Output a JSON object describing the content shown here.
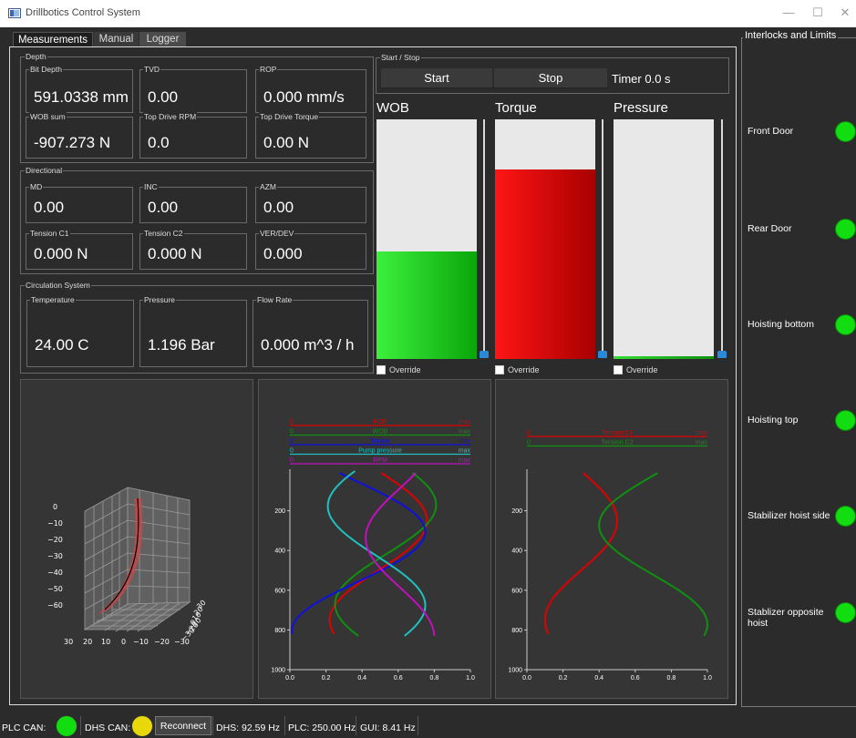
{
  "window": {
    "title": "Drillbotics Control System",
    "minimize": "—",
    "maximize": "☐",
    "close": "✕"
  },
  "tabs": [
    "Measurements",
    "Manual",
    "Logger"
  ],
  "depth": {
    "title": "Depth",
    "fields": [
      {
        "label": "Bit Depth",
        "value": "591.0338 mm"
      },
      {
        "label": "TVD",
        "value": "0.00"
      },
      {
        "label": "ROP",
        "value": "0.000 mm/s"
      },
      {
        "label": "WOB sum",
        "value": "-907.273 N"
      },
      {
        "label": "Top Drive RPM",
        "value": "0.0"
      },
      {
        "label": "Top Drive Torque",
        "value": "0.00 N"
      }
    ]
  },
  "directional": {
    "title": "Directional",
    "fields": [
      {
        "label": "MD",
        "value": "0.00"
      },
      {
        "label": "INC",
        "value": "0.00"
      },
      {
        "label": "AZM",
        "value": "0.00"
      },
      {
        "label": "Tension C1",
        "value": "0.000 N"
      },
      {
        "label": "Tension C2",
        "value": "0.000 N"
      },
      {
        "label": "VER/DEV",
        "value": "0.000"
      }
    ]
  },
  "circulation": {
    "title": "Circulation System",
    "fields": [
      {
        "label": "Temperature",
        "value": "24.00 C"
      },
      {
        "label": "Pressure",
        "value": "1.196 Bar"
      },
      {
        "label": "Flow Rate",
        "value": "0.000 m^3 / h"
      }
    ]
  },
  "start_stop": {
    "title": "Start / Stop",
    "start": "Start",
    "stop": "Stop",
    "timer": "Timer 0.0 s"
  },
  "gauges": [
    {
      "name": "WOB",
      "fill": 0.45,
      "color": "#1fd11f",
      "override": "Override"
    },
    {
      "name": "Torque",
      "fill": 0.79,
      "color": "#e00000",
      "override": "Override"
    },
    {
      "name": "Pressure",
      "fill": 0.01,
      "color": "#22b822",
      "override": "Override"
    }
  ],
  "plot3d": {
    "z_ticks": [
      "0",
      "−10",
      "−20",
      "−30",
      "−40",
      "−50",
      "−60"
    ],
    "x_ticks": [
      "30",
      "20",
      "10",
      "0",
      "−10",
      "−20",
      "−30"
    ],
    "y_ticks": [
      "30",
      "20",
      "10",
      "0",
      "−10",
      "−20",
      "−30"
    ]
  },
  "chart_data": [
    {
      "type": "line",
      "legend": [
        {
          "name": "ROP",
          "min": "0",
          "max": "max",
          "color": "#e00000"
        },
        {
          "name": "WOB",
          "min": "0",
          "max": "max",
          "color": "#109010"
        },
        {
          "name": "Torque",
          "min": "0",
          "max": "max",
          "color": "#1010e0"
        },
        {
          "name": "Pump pressure",
          "min": "0",
          "max": "max",
          "color": "#20c0c0"
        },
        {
          "name": "RPM",
          "min": "0",
          "max": "max",
          "color": "#c010c0"
        }
      ],
      "xlim": [
        0,
        1
      ],
      "ylim": [
        1000,
        0
      ],
      "y_inverted": true,
      "x_ticks": [
        "0.0",
        "0.2",
        "0.4",
        "0.6",
        "0.8",
        "1.0"
      ],
      "y_ticks": [
        "200",
        "400",
        "600",
        "800",
        "1000"
      ],
      "series": [
        {
          "name": "ROP",
          "color": "#e00000",
          "center": 0.49,
          "amp": 0.27,
          "phase": 0.0,
          "y0": 10,
          "y1": 820
        },
        {
          "name": "WOB",
          "color": "#109010",
          "center": 0.53,
          "amp": 0.28,
          "phase": 0.5,
          "y0": 10,
          "y1": 830
        },
        {
          "name": "Torque",
          "color": "#1010e0",
          "center": 0.38,
          "amp": 0.37,
          "phase": -0.35,
          "y0": 10,
          "y1": 820
        },
        {
          "name": "Pump pressure",
          "color": "#20c0c0",
          "center": 0.48,
          "amp": 0.27,
          "phase": 3.6,
          "y0": 0,
          "y1": 830
        },
        {
          "name": "RPM",
          "color": "#c010c0",
          "center": 0.61,
          "amp": 0.19,
          "phase": 2.6,
          "y0": 10,
          "y1": 830
        }
      ]
    },
    {
      "type": "line",
      "legend": [
        {
          "name": "Tension C1",
          "min": "0",
          "max": "max",
          "color": "#e00000"
        },
        {
          "name": "Tension C2",
          "min": "0",
          "max": "max",
          "color": "#109010"
        }
      ],
      "xlim": [
        0,
        1
      ],
      "ylim": [
        1000,
        0
      ],
      "y_inverted": true,
      "x_ticks": [
        "0.0",
        "0.2",
        "0.4",
        "0.6",
        "0.8",
        "1.0"
      ],
      "y_ticks": [
        "200",
        "400",
        "600",
        "800",
        "1000"
      ],
      "series": [
        {
          "name": "Tension C1",
          "color": "#e00000",
          "center": 0.3,
          "amp": 0.2,
          "phase": 0.0,
          "y0": 10,
          "y1": 820
        },
        {
          "name": "Tension C2",
          "color": "#109010",
          "center": 0.7,
          "amp": 0.3,
          "phase": 3.0,
          "y0": 10,
          "y1": 830
        }
      ]
    }
  ],
  "interlocks": {
    "title": "Interlocks and Limits",
    "items": [
      {
        "label": "Front Door",
        "color": "#11dd11"
      },
      {
        "label": "Rear Door",
        "color": "#11dd11"
      },
      {
        "label": "Hoisting bottom",
        "color": "#11dd11"
      },
      {
        "label": "Hoisting top",
        "color": "#11dd11"
      },
      {
        "label": "Stabilizer hoist side",
        "color": "#11dd11"
      },
      {
        "label": "Stablizer opposite hoist",
        "color": "#11dd11"
      }
    ]
  },
  "status": {
    "plc_can": "PLC CAN:",
    "plc_color": "#11dd11",
    "dhs_can": "DHS CAN:",
    "dhs_color": "#e8d80a",
    "reconnect": "Reconnect",
    "dhs_rate": "DHS: 92.59 Hz",
    "plc_rate": "PLC: 250.00 Hz",
    "gui_rate": "GUI: 8.41 Hz"
  }
}
